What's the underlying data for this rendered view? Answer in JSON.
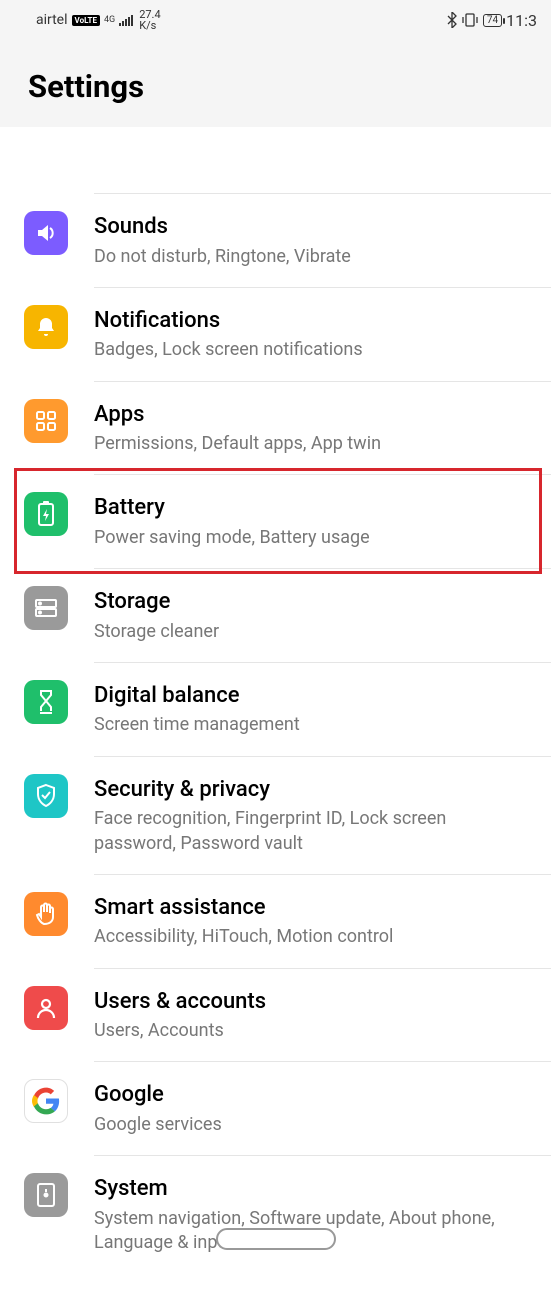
{
  "status": {
    "carrier": "airtel",
    "volte": "VoLTE",
    "net": "4G",
    "speed_top": "27.4",
    "speed_bot": "K/s",
    "battery": "74",
    "time": "11:3"
  },
  "header": {
    "title": "Settings"
  },
  "items": [
    {
      "title": "Sounds",
      "sub": "Do not disturb, Ringtone, Vibrate"
    },
    {
      "title": "Notifications",
      "sub": "Badges, Lock screen notifications"
    },
    {
      "title": "Apps",
      "sub": "Permissions, Default apps, App twin"
    },
    {
      "title": "Battery",
      "sub": "Power saving mode, Battery usage"
    },
    {
      "title": "Storage",
      "sub": "Storage cleaner"
    },
    {
      "title": "Digital balance",
      "sub": "Screen time management"
    },
    {
      "title": "Security & privacy",
      "sub": "Face recognition, Fingerprint ID, Lock screen password, Password vault"
    },
    {
      "title": "Smart assistance",
      "sub": "Accessibility, HiTouch, Motion control"
    },
    {
      "title": "Users & accounts",
      "sub": "Users, Accounts"
    },
    {
      "title": "Google",
      "sub": "Google services"
    },
    {
      "title": "System",
      "sub": "System navigation, Software update, About phone, Language & input"
    }
  ]
}
